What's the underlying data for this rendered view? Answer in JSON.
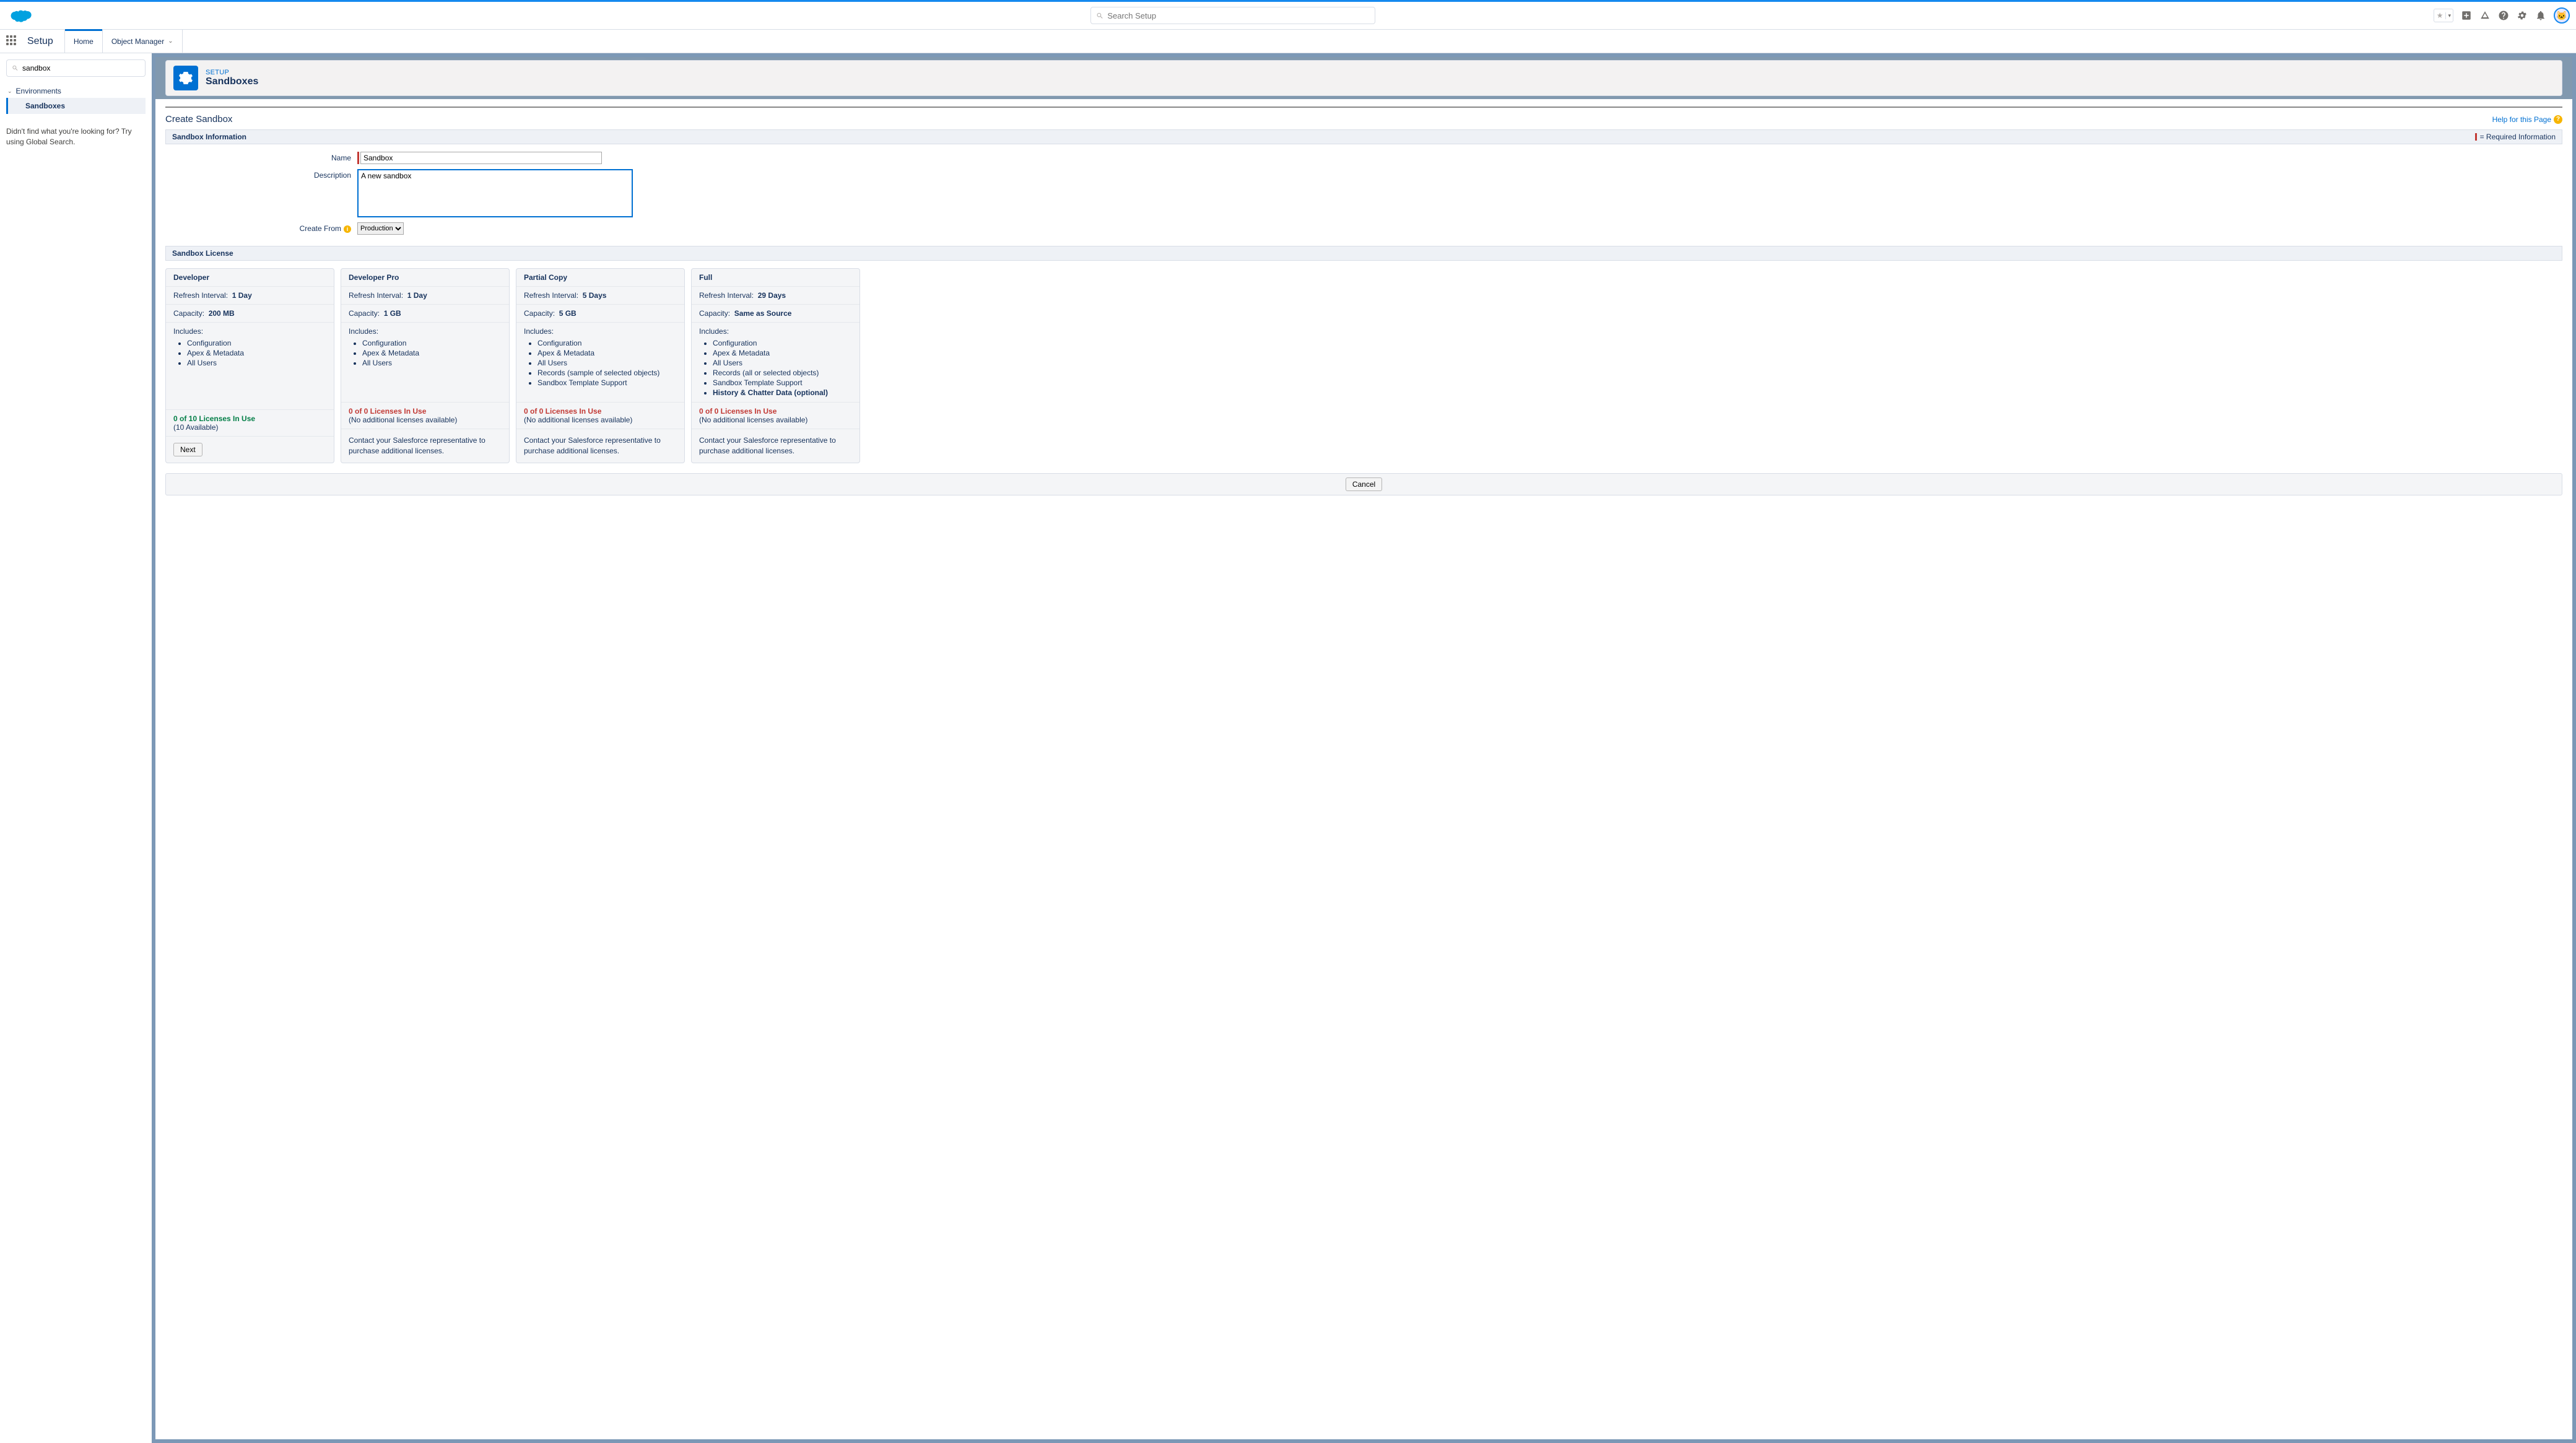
{
  "globalSearch": {
    "placeholder": "Search Setup"
  },
  "nav": {
    "appName": "Setup",
    "tabs": [
      "Home",
      "Object Manager"
    ],
    "activeTab": "Home"
  },
  "sidebar": {
    "quickFindValue": "sandbox",
    "tree": {
      "parent": "Environments",
      "child": "Sandboxes"
    },
    "hint": "Didn't find what you're looking for? Try using Global Search."
  },
  "pageHeader": {
    "eyebrow": "SETUP",
    "title": "Sandboxes"
  },
  "content": {
    "heading": "Create Sandbox",
    "helpLabel": "Help for this Page",
    "sectionInfo": "Sandbox Information",
    "requiredLegend": "= Required Information",
    "form": {
      "nameLabel": "Name",
      "nameValue": "Sandbox",
      "descLabel": "Description",
      "descValue": "A new sandbox",
      "createFromLabel": "Create From",
      "createFromValue": "Production"
    },
    "sectionLicense": "Sandbox License",
    "licenses": [
      {
        "title": "Developer",
        "interval": "1 Day",
        "capacity": "200 MB",
        "includes": [
          "Configuration",
          "Apex & Metadata",
          "All Users"
        ],
        "inUse": "0 of 10 Licenses In Use",
        "inUseClass": "inuse-green",
        "avail": "(10 Available)",
        "action": {
          "type": "button",
          "label": "Next"
        }
      },
      {
        "title": "Developer Pro",
        "interval": "1 Day",
        "capacity": "1 GB",
        "includes": [
          "Configuration",
          "Apex & Metadata",
          "All Users"
        ],
        "inUse": "0 of 0 Licenses In Use",
        "inUseClass": "inuse-red",
        "avail": "(No additional licenses available)",
        "action": {
          "type": "text",
          "label": "Contact your Salesforce representative to purchase additional licenses."
        }
      },
      {
        "title": "Partial Copy",
        "interval": "5 Days",
        "capacity": "5 GB",
        "includes": [
          "Configuration",
          "Apex & Metadata",
          "All Users",
          "Records (sample of selected objects)",
          "Sandbox Template Support"
        ],
        "inUse": "0 of 0 Licenses In Use",
        "inUseClass": "inuse-red",
        "avail": "(No additional licenses available)",
        "action": {
          "type": "text",
          "label": "Contact your Salesforce representative to purchase additional licenses."
        }
      },
      {
        "title": "Full",
        "interval": "29 Days",
        "capacity": "Same as Source",
        "includes": [
          "Configuration",
          "Apex & Metadata",
          "All Users",
          "Records (all or selected objects)",
          "Sandbox Template Support",
          "History & Chatter Data (optional)"
        ],
        "boldLast": true,
        "inUse": "0 of 0 Licenses In Use",
        "inUseClass": "inuse-red",
        "avail": "(No additional licenses available)",
        "action": {
          "type": "text",
          "label": "Contact your Salesforce representative to purchase additional licenses."
        }
      }
    ],
    "labels": {
      "refresh": "Refresh Interval:",
      "capacity": "Capacity:",
      "includes": "Includes:"
    },
    "cancelLabel": "Cancel"
  }
}
